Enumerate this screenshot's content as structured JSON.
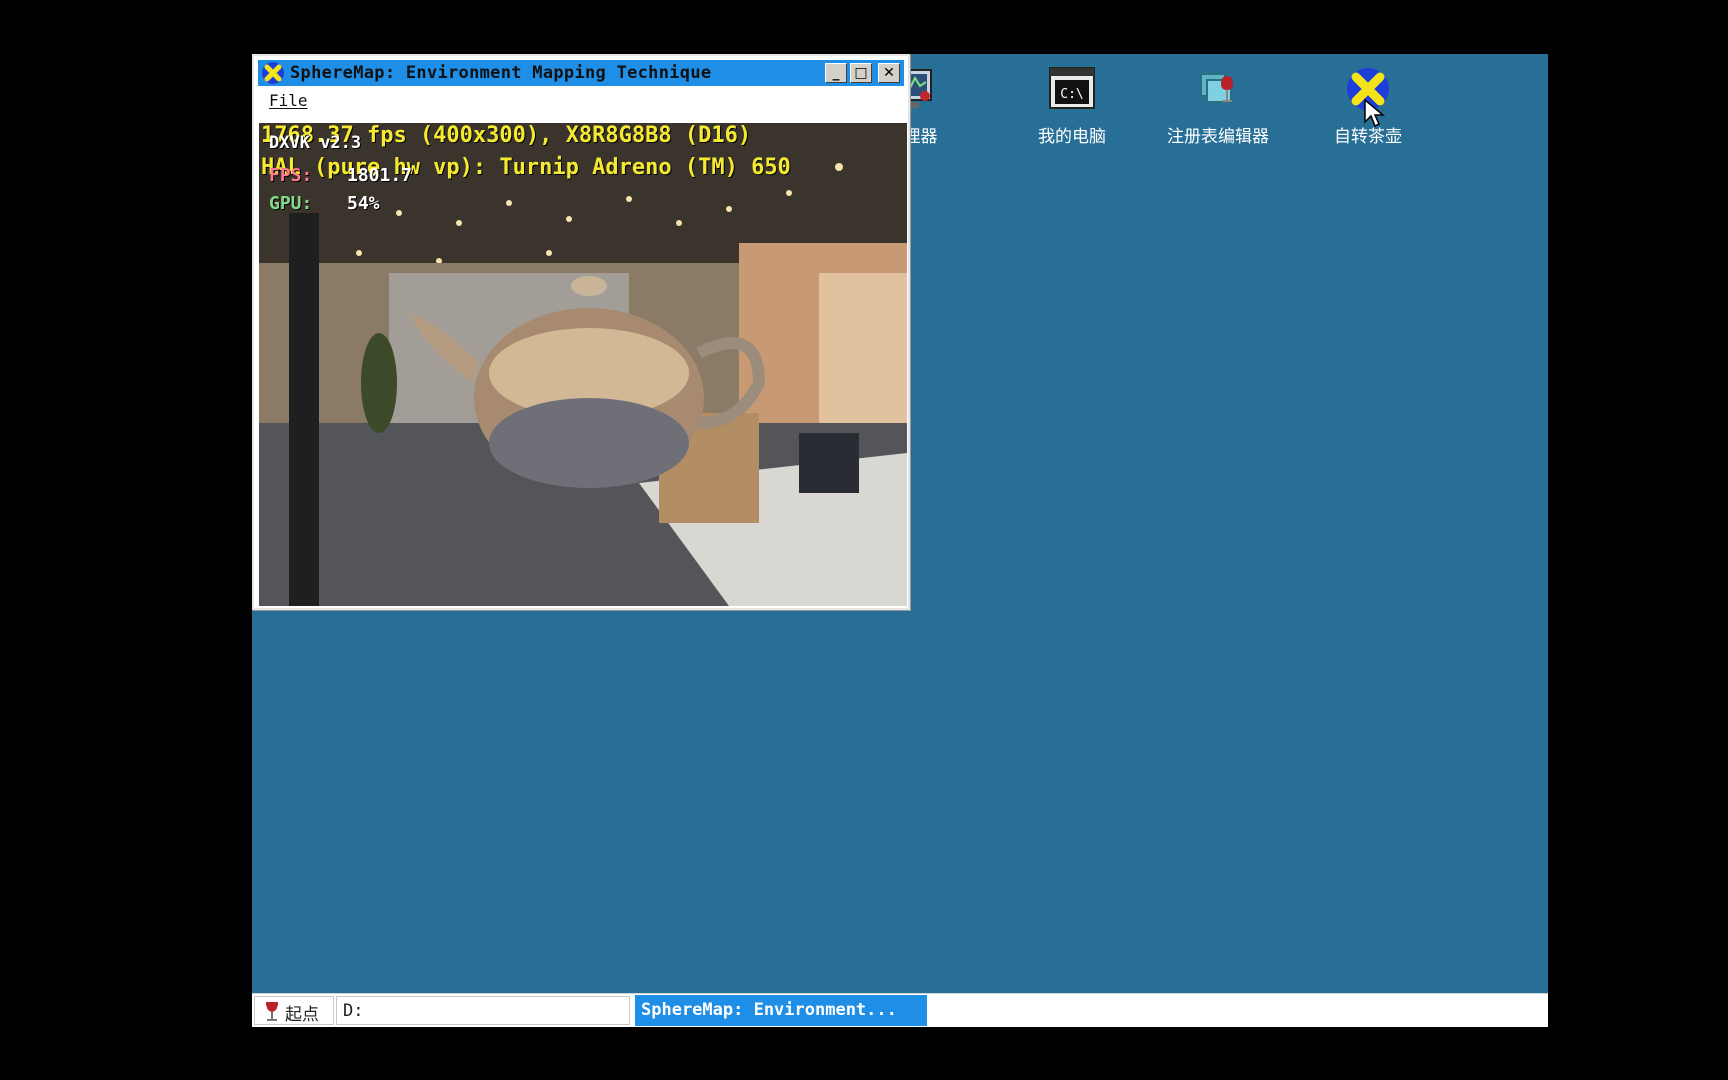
{
  "desktop": {
    "icons": [
      {
        "label": "管理器",
        "icon": "task-manager-icon"
      },
      {
        "label": "我的电脑",
        "icon": "my-computer-icon"
      },
      {
        "label": "注册表编辑器",
        "icon": "registry-editor-icon"
      },
      {
        "label": "自转茶壶",
        "icon": "spinning-teapot-icon"
      }
    ],
    "background_color": "#276f97"
  },
  "window": {
    "title": "SphereMap: Environment Mapping Technique",
    "menu": {
      "file": "File"
    },
    "buttons": {
      "minimize": "_",
      "maximize": "□",
      "close": "✕"
    },
    "overlay": {
      "stats_line": "1768.37 fps (400x300), X8R8G8B8 (D16)",
      "device_line": "HAL (pure hw vp): Turnip Adreno (TM) 650",
      "dxvk_version": "DXVK v2.3",
      "fps_label": "FPS:",
      "fps_value": "1801.7",
      "gpu_label": "GPU:",
      "gpu_value": "54%"
    }
  },
  "taskbar": {
    "start_label": "起点",
    "drive_label": "D:",
    "active_task": "SphereMap: Environment..."
  },
  "accent_color": "#1e8ee6"
}
